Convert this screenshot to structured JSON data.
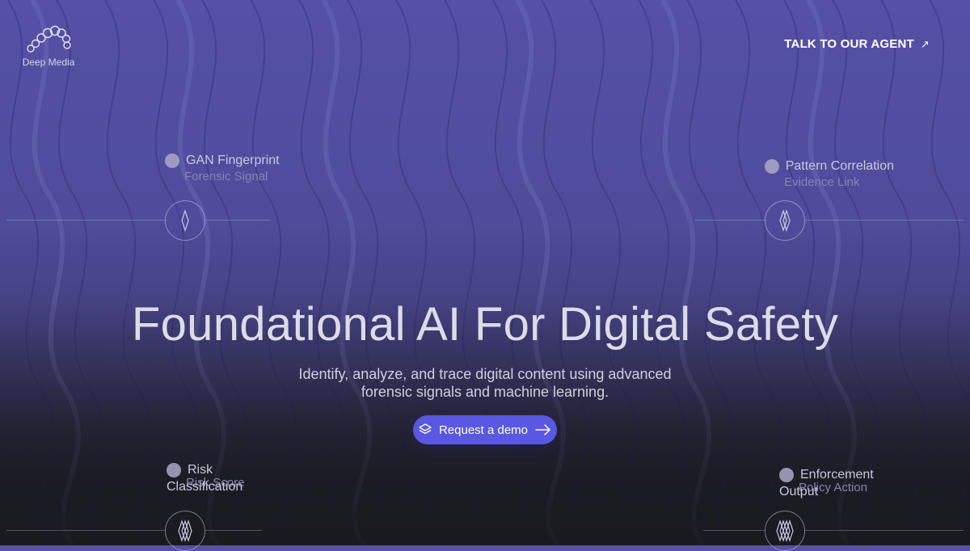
{
  "brand": {
    "name": "Deep Media"
  },
  "header": {
    "cta_label": "TALK TO OUR AGENT",
    "cta_icon": "arrow-up-right-icon"
  },
  "hero": {
    "title": "Foundational AI For Digital Safety",
    "subtitle_line1": "Identify, analyze, and trace digital content using advanced",
    "subtitle_line2": "forensic signals and machine learning.",
    "button_label": "Request a demo",
    "button_icon": "layers-icon",
    "button_arrow_icon": "arrow-right-icon"
  },
  "nodes": {
    "top_left": {
      "title": "GAN Fingerprint",
      "sub": "Forensic Signal"
    },
    "top_right": {
      "title": "Pattern Correlation",
      "sub": "Evidence Link"
    },
    "bottom_left": {
      "title": "Risk",
      "title2": "Classification",
      "sub": "Risk Score"
    },
    "bottom_right": {
      "title": "Enforcement",
      "title2": "Output",
      "sub": "Policy Action"
    }
  },
  "colors": {
    "accent": "#5a57e0",
    "background_top": "#5451a6",
    "background_bottom": "#1e1e26"
  }
}
